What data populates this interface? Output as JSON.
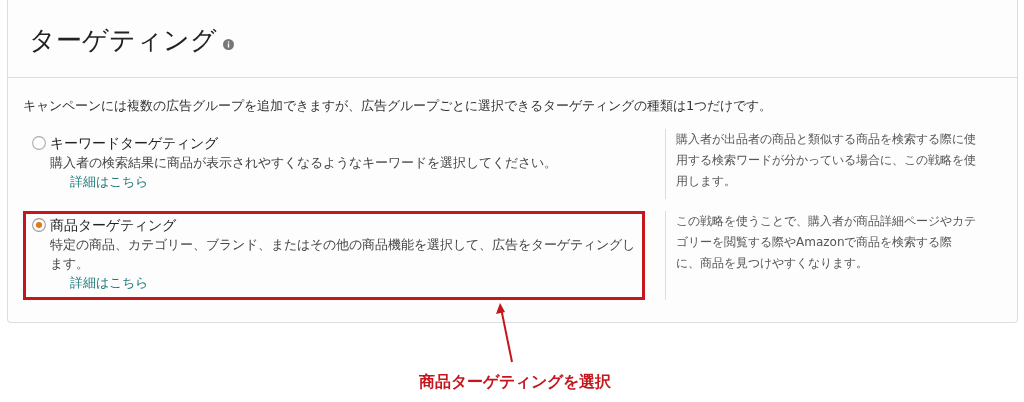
{
  "panel": {
    "title": "ターゲティング",
    "intro": "キャンペーンには複数の広告グループを追加できますが、広告グループごとに選択できるターゲティングの種類は1つだけです。",
    "options": [
      {
        "label": "キーワードターゲティング",
        "description": "購入者の検索結果に商品が表示されやすくなるようなキーワードを選択してください。",
        "link": "詳細はこちら",
        "help": "購入者が出品者の商品と類似する商品を検索する際に使用する検索ワードが分かっている場合に、この戦略を使用します。",
        "selected": false,
        "highlighted": false
      },
      {
        "label": "商品ターゲティング",
        "description": "特定の商品、カテゴリー、ブランド、またはその他の商品機能を選択して、広告をターゲティングします。",
        "link": "詳細はこちら",
        "help": "この戦略を使うことで、購入者が商品詳細ページやカテゴリーを閲覧する際やAmazonで商品を検索する際に、商品を見つけやすくなります。",
        "selected": true,
        "highlighted": true
      }
    ]
  },
  "annotation": {
    "label": "商品ターゲティングを選択"
  }
}
